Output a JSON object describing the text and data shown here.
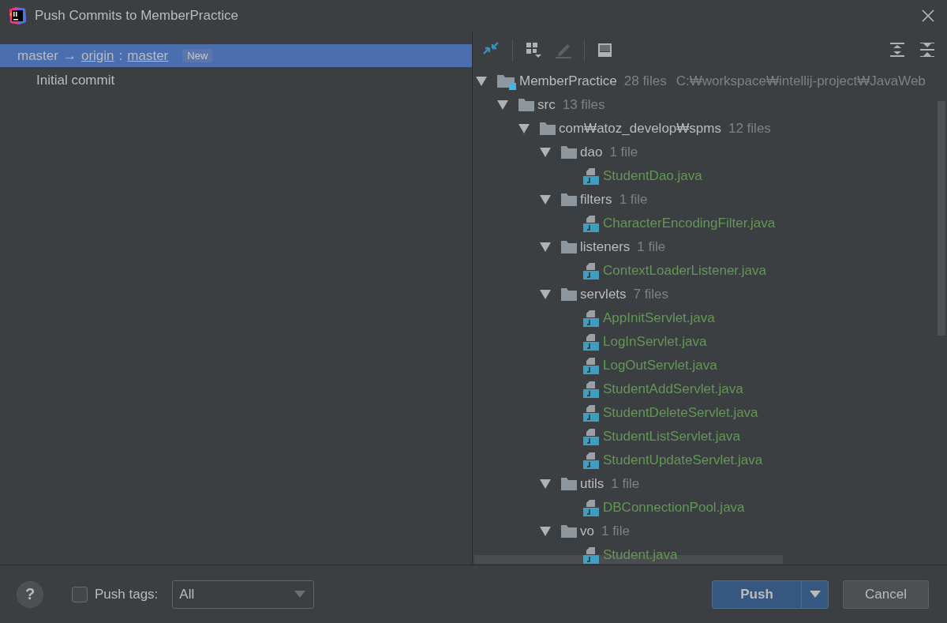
{
  "window": {
    "title": "Push Commits to MemberPractice"
  },
  "push_spec": {
    "source": "master",
    "arrow": "→",
    "remote": "origin",
    "separator": ":",
    "target": "master",
    "badge": "New",
    "selected": true
  },
  "commits": [
    {
      "message": "Initial commit",
      "selected": false
    }
  ],
  "toolbar": [
    {
      "kind": "diff",
      "disabled": false
    },
    {
      "kind": "group",
      "disabled": false
    },
    {
      "kind": "edit",
      "disabled": true
    },
    {
      "kind": "preview",
      "disabled": false
    },
    {
      "kind": "expand_all",
      "disabled": false
    },
    {
      "kind": "collapse_all",
      "disabled": false
    }
  ],
  "tree": [
    {
      "kind": "module",
      "name": "MemberPractice",
      "count": "28 files",
      "path": "C:₩workspace₩intellij-project₩JavaWeb",
      "expanded": true,
      "children": [
        {
          "kind": "folder",
          "name": "src",
          "count": "13 files",
          "expanded": true,
          "children": [
            {
              "kind": "folder",
              "name": "com₩atoz_develop₩spms",
              "count": "12 files",
              "expanded": true,
              "children": [
                {
                  "kind": "folder",
                  "name": "dao",
                  "count": "1 file",
                  "expanded": true,
                  "children": [
                    {
                      "kind": "file",
                      "name": "StudentDao.java"
                    }
                  ]
                },
                {
                  "kind": "folder",
                  "name": "filters",
                  "count": "1 file",
                  "expanded": true,
                  "children": [
                    {
                      "kind": "file",
                      "name": "CharacterEncodingFilter.java"
                    }
                  ]
                },
                {
                  "kind": "folder",
                  "name": "listeners",
                  "count": "1 file",
                  "expanded": true,
                  "children": [
                    {
                      "kind": "file",
                      "name": "ContextLoaderListener.java"
                    }
                  ]
                },
                {
                  "kind": "folder",
                  "name": "servlets",
                  "count": "7 files",
                  "expanded": true,
                  "children": [
                    {
                      "kind": "file",
                      "name": "AppInitServlet.java"
                    },
                    {
                      "kind": "file",
                      "name": "LogInServlet.java"
                    },
                    {
                      "kind": "file",
                      "name": "LogOutServlet.java"
                    },
                    {
                      "kind": "file",
                      "name": "StudentAddServlet.java"
                    },
                    {
                      "kind": "file",
                      "name": "StudentDeleteServlet.java"
                    },
                    {
                      "kind": "file",
                      "name": "StudentListServlet.java"
                    },
                    {
                      "kind": "file",
                      "name": "StudentUpdateServlet.java"
                    }
                  ]
                },
                {
                  "kind": "folder",
                  "name": "utils",
                  "count": "1 file",
                  "expanded": true,
                  "children": [
                    {
                      "kind": "file",
                      "name": "DBConnectionPool.java"
                    }
                  ]
                },
                {
                  "kind": "folder",
                  "name": "vo",
                  "count": "1 file",
                  "expanded": true,
                  "children": [
                    {
                      "kind": "file",
                      "name": "Student.java"
                    }
                  ]
                }
              ]
            }
          ]
        }
      ]
    }
  ],
  "footer": {
    "help": "?",
    "push_tags": {
      "label": "Push tags:",
      "checked": false
    },
    "tags_dropdown": {
      "value": "All"
    },
    "buttons": [
      {
        "label": "Push",
        "kind": "primary"
      },
      {
        "label": "Cancel",
        "kind": "secondary"
      }
    ]
  }
}
